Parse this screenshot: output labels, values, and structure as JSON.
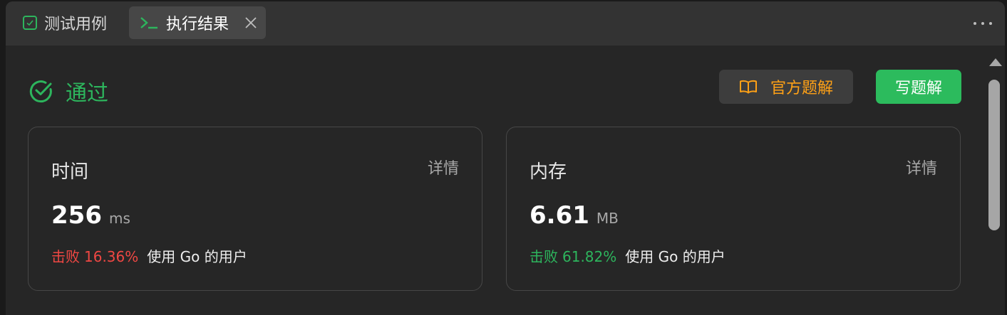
{
  "tabs": [
    {
      "label": "测试用例",
      "icon": "checkbox-icon"
    },
    {
      "label": "执行结果",
      "icon": "terminal-icon"
    }
  ],
  "status": {
    "text": "通过",
    "icon": "check-circle-icon"
  },
  "actions": {
    "official_solution": "官方题解",
    "write_solution": "写题解"
  },
  "cards": {
    "time": {
      "title": "时间",
      "detail": "详情",
      "value": "256",
      "unit": "ms",
      "beat_label": "击败",
      "beat_pct": "16.36%",
      "users": "使用 Go 的用户"
    },
    "memory": {
      "title": "内存",
      "detail": "详情",
      "value": "6.61",
      "unit": "MB",
      "beat_label": "击败",
      "beat_pct": "61.82%",
      "users": "使用 Go 的用户"
    }
  },
  "colors": {
    "accent_green": "#2db55d",
    "accent_orange": "#ffa116",
    "accent_red": "#ef4743",
    "background": "#262626"
  }
}
